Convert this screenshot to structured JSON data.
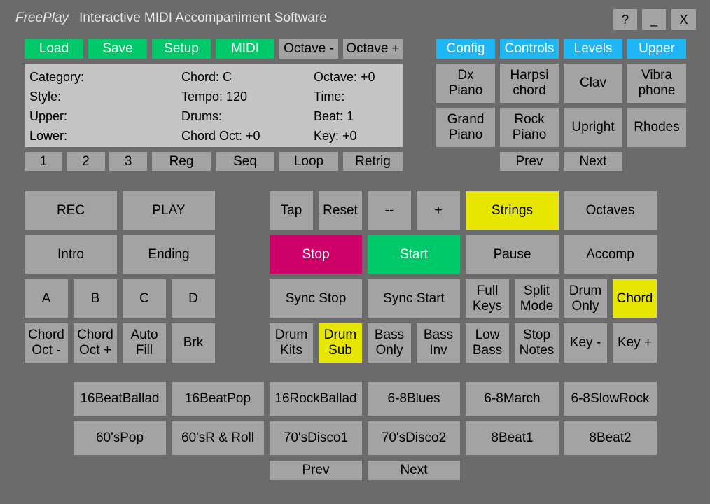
{
  "titlebar": {
    "app_name": "FreePlay",
    "subtitle": "Interactive MIDI Accompaniment Software",
    "help": "?",
    "minimize": "_",
    "close": "X"
  },
  "top_menu": {
    "load": "Load",
    "save": "Save",
    "setup": "Setup",
    "midi": "MIDI",
    "octave_minus": "Octave -",
    "octave_plus": "Octave +"
  },
  "info": {
    "category": "Category:",
    "style": "Style:",
    "upper": "Upper:",
    "lower": "Lower:",
    "chord": "Chord: C",
    "tempo": "Tempo: 120",
    "drums": "Drums:",
    "chord_oct": "Chord Oct: +0",
    "octave": "Octave: +0",
    "time": "Time:",
    "beat": "Beat: 1",
    "key": "Key: +0"
  },
  "registration": {
    "r1": "1",
    "r2": "2",
    "r3": "3",
    "reg": "Reg",
    "seq": "Seq",
    "loop": "Loop",
    "retrig": "Retrig"
  },
  "right_tabs": {
    "config": "Config",
    "controls": "Controls",
    "levels": "Levels",
    "upper": "Upper"
  },
  "instruments": [
    "Dx\nPiano",
    "Harpsi\nchord",
    "Clav",
    "Vibra\nphone",
    "Grand\nPiano",
    "Rock\nPiano",
    "Upright",
    "Rhodes"
  ],
  "instrument_nav": {
    "prev": "Prev",
    "next": "Next"
  },
  "left_pad": {
    "rec": "REC",
    "play": "PLAY",
    "intro": "Intro",
    "ending": "Ending",
    "a": "A",
    "b": "B",
    "c": "C",
    "d": "D",
    "chord_oct_minus": "Chord\nOct -",
    "chord_oct_plus": "Chord\nOct +",
    "auto_fill": "Auto\nFill",
    "brk": "Brk"
  },
  "control_pad": {
    "tap": "Tap",
    "reset": "Reset",
    "minus": "--",
    "plus": "+",
    "strings": "Strings",
    "octaves": "Octaves",
    "stop": "Stop",
    "start": "Start",
    "pause": "Pause",
    "accomp": "Accomp",
    "sync_stop": "Sync Stop",
    "sync_start": "Sync Start",
    "full_keys": "Full\nKeys",
    "split_mode": "Split\nMode",
    "drum_only": "Drum\nOnly",
    "chord": "Chord",
    "drum_kits": "Drum\nKits",
    "drum_sub": "Drum\nSub",
    "bass_only": "Bass\nOnly",
    "bass_inv": "Bass\nInv",
    "low_bass": "Low\nBass",
    "stop_notes": "Stop\nNotes",
    "key_minus": "Key -",
    "key_plus": "Key +"
  },
  "styles": [
    "16BeatBallad",
    "16BeatPop",
    "16RockBallad",
    "6-8Blues",
    "6-8March",
    "6-8SlowRock",
    "60'sPop",
    "60'sR & Roll",
    "70'sDisco1",
    "70'sDisco2",
    "8Beat1",
    "8Beat2"
  ],
  "style_nav": {
    "prev": "Prev",
    "next": "Next"
  },
  "colors": {
    "background": "#6b6b6b",
    "button": "#a3a3a3",
    "green": "#00c969",
    "blue": "#1fb6f5",
    "yellow": "#e6e600",
    "magenta": "#cc0066"
  }
}
